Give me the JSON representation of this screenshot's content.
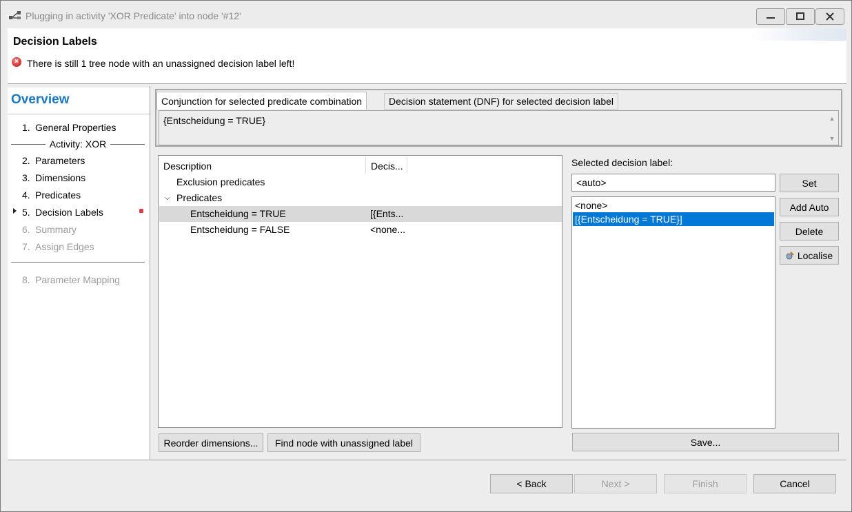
{
  "window": {
    "title": "Plugging in activity 'XOR Predicate' into node '#12'",
    "minimize_label": "",
    "maximize_label": "",
    "close_label": ""
  },
  "header": {
    "title": "Decision Labels",
    "message": "There is still 1 tree node with an unassigned decision label left!"
  },
  "nav": {
    "title": "Overview",
    "items": [
      {
        "num": "1.",
        "label": "General Properties"
      },
      {
        "num": "2.",
        "label": "Parameters"
      },
      {
        "num": "3.",
        "label": "Dimensions"
      },
      {
        "num": "4.",
        "label": "Predicates"
      },
      {
        "num": "5.",
        "label": "Decision Labels"
      },
      {
        "num": "6.",
        "label": "Summary"
      },
      {
        "num": "7.",
        "label": "Assign Edges"
      },
      {
        "num": "8.",
        "label": "Parameter Mapping"
      }
    ],
    "group_label": "Activity: XOR"
  },
  "tabs": {
    "items": [
      {
        "label": "Conjunction for selected predicate combination"
      },
      {
        "label": "Decision statement (DNF) for selected decision label"
      }
    ],
    "content": "{Entscheidung = TRUE}"
  },
  "tree": {
    "columns": [
      "Description",
      "Decis..."
    ],
    "rows": [
      {
        "description": "Exclusion predicates",
        "decision": ""
      },
      {
        "description": "Predicates",
        "decision": ""
      },
      {
        "description": "Entscheidung = TRUE",
        "decision": "[{Ents..."
      },
      {
        "description": "Entscheidung = FALSE",
        "decision": "<none..."
      }
    ]
  },
  "decision_panel": {
    "label": "Selected decision label:",
    "input_value": "<auto>",
    "list": [
      "<none>",
      "[{Entscheidung = TRUE}]"
    ],
    "set_label": "Set",
    "add_auto_label": "Add Auto",
    "delete_label": "Delete",
    "localise_label": "Localise",
    "save_label": "Save..."
  },
  "tree_buttons": {
    "reorder_label": "Reorder dimensions...",
    "find_label": "Find node with unassigned label"
  },
  "footer": {
    "back_label": "< Back",
    "next_label": "Next >",
    "finish_label": "Finish",
    "cancel_label": "Cancel"
  }
}
